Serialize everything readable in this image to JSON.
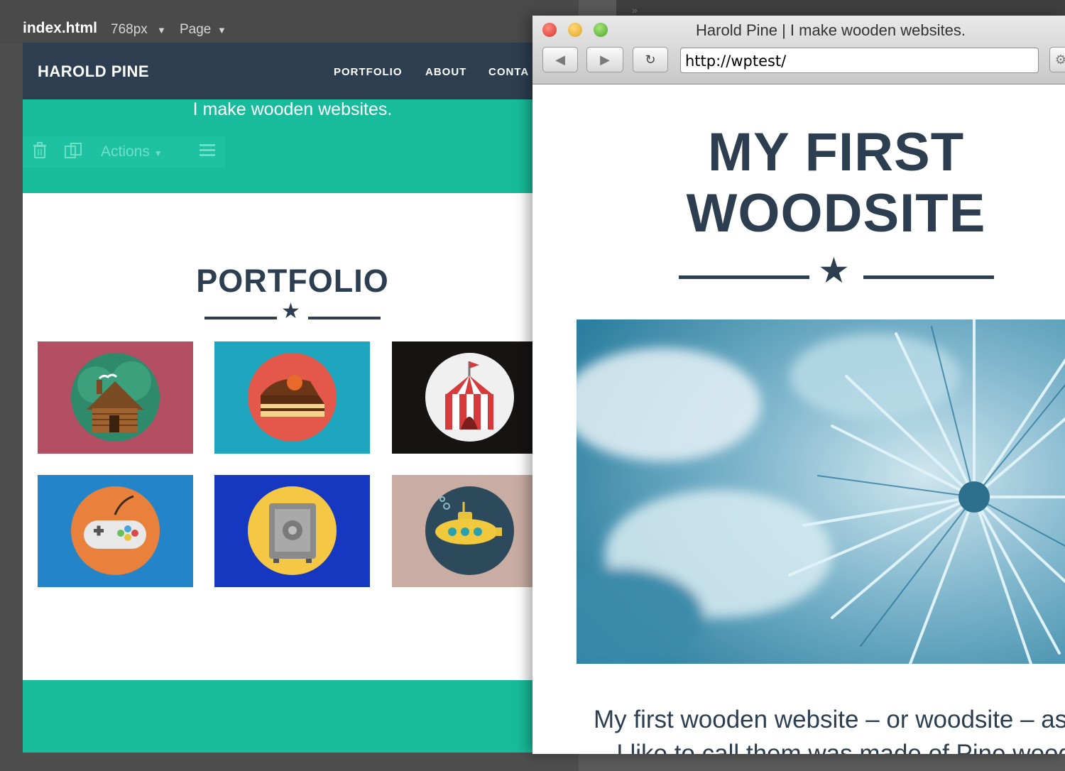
{
  "editor": {
    "file_name": "index.html",
    "width_label": "768px",
    "page_menu": "Page",
    "actions_label": "Actions"
  },
  "site_preview": {
    "brand": "HAROLD PINE",
    "nav": [
      "PORTFOLIO",
      "ABOUT",
      "CONTA"
    ],
    "tagline": "I make wooden websites.",
    "section_title": "PORTFOLIO",
    "tiles": [
      {
        "icon": "cabin-icon",
        "bg": "#b44e63",
        "circle": "#2f8a6c"
      },
      {
        "icon": "cake-icon",
        "bg": "#1fa6bf",
        "circle": "#e3584a"
      },
      {
        "icon": "circus-tent-icon",
        "bg": "#161313",
        "circle": "#f0f0f0"
      },
      {
        "icon": "game-controller-icon",
        "bg": "#2484c8",
        "circle": "#e9813c"
      },
      {
        "icon": "safe-icon",
        "bg": "#1638c0",
        "circle": "#f4c745"
      },
      {
        "icon": "submarine-icon",
        "bg": "#c9ada2",
        "circle": "#2d4a5c"
      }
    ]
  },
  "browser": {
    "window_title": "Harold Pine | I make wooden websites.",
    "url": "http://wptest/",
    "site_title_line1": "MY FIRST",
    "site_title_line2": "WOODSITE",
    "post_text_line1": "My first wooden website – or woodsite – as",
    "post_text_line2": "I like to call them was made of Pine wood."
  },
  "colors": {
    "navy": "#2c3e50",
    "turquoise": "#18bc9c"
  }
}
